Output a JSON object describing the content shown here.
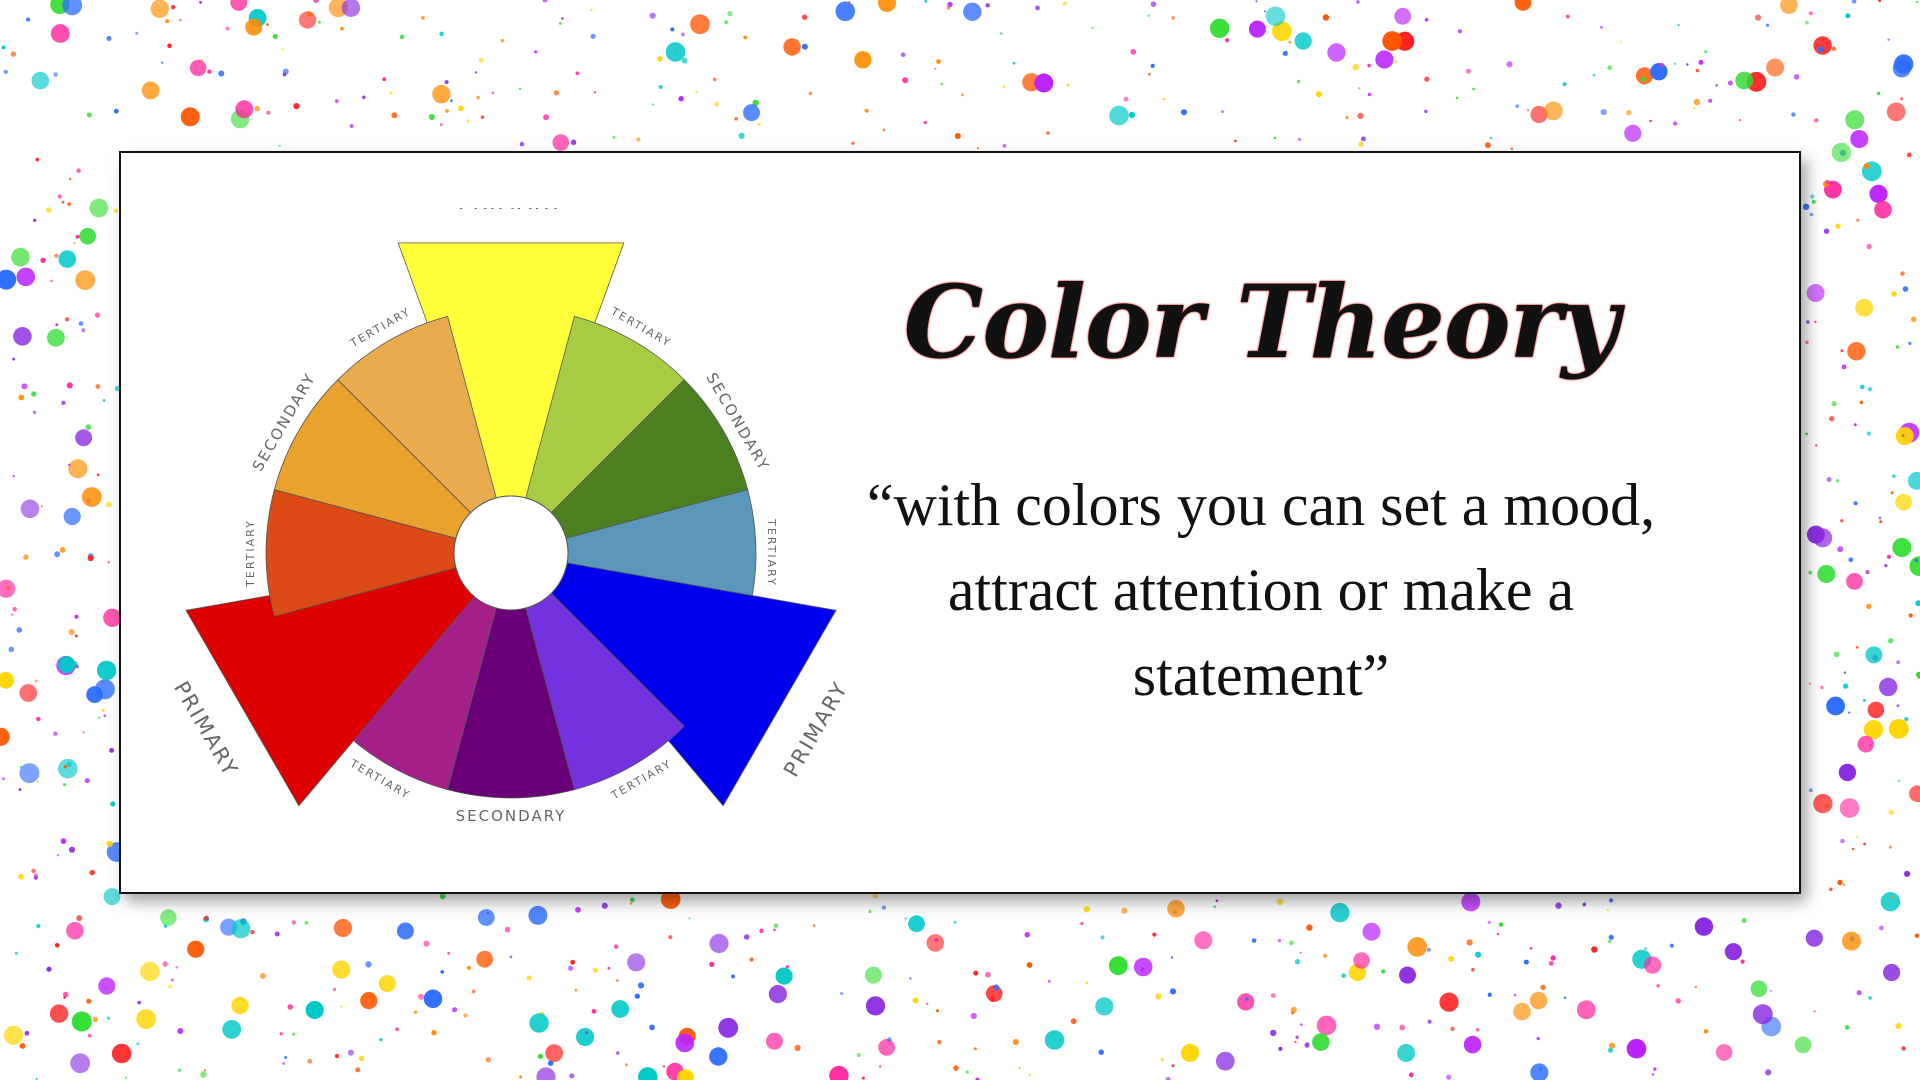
{
  "slide": {
    "title": "Color Theory",
    "quote": "“with colors you can set a mood, attract attention or make a statement”"
  },
  "wheel": {
    "labels": {
      "primary": "PRIMARY",
      "secondary": "SECONDARY",
      "tertiary": "TERTIARY"
    },
    "segments": [
      {
        "name": "yellow",
        "role": "primary",
        "color": "#ffff3a"
      },
      {
        "name": "yellow-green",
        "role": "tertiary",
        "color": "#a8cc44"
      },
      {
        "name": "green",
        "role": "secondary",
        "color": "#4b7f1f"
      },
      {
        "name": "blue-green",
        "role": "tertiary",
        "color": "#5a97b8"
      },
      {
        "name": "blue",
        "role": "primary",
        "color": "#0000ee"
      },
      {
        "name": "blue-violet",
        "role": "tertiary",
        "color": "#7431e0"
      },
      {
        "name": "violet",
        "role": "secondary",
        "color": "#6a0078"
      },
      {
        "name": "red-violet",
        "role": "tertiary",
        "color": "#a3208a"
      },
      {
        "name": "red",
        "role": "primary",
        "color": "#dd0000"
      },
      {
        "name": "red-orange",
        "role": "tertiary",
        "color": "#dc4a16"
      },
      {
        "name": "orange",
        "role": "secondary",
        "color": "#e9a22c"
      },
      {
        "name": "yellow-orange",
        "role": "tertiary",
        "color": "#e8ac4e"
      }
    ]
  },
  "splatter_colors": [
    "#ff2aa0",
    "#8a2be2",
    "#33dd33",
    "#ffd500",
    "#ff5500",
    "#2a6bff",
    "#ff1f1f",
    "#bb22ff",
    "#00c8c8",
    "#ff8c00"
  ]
}
